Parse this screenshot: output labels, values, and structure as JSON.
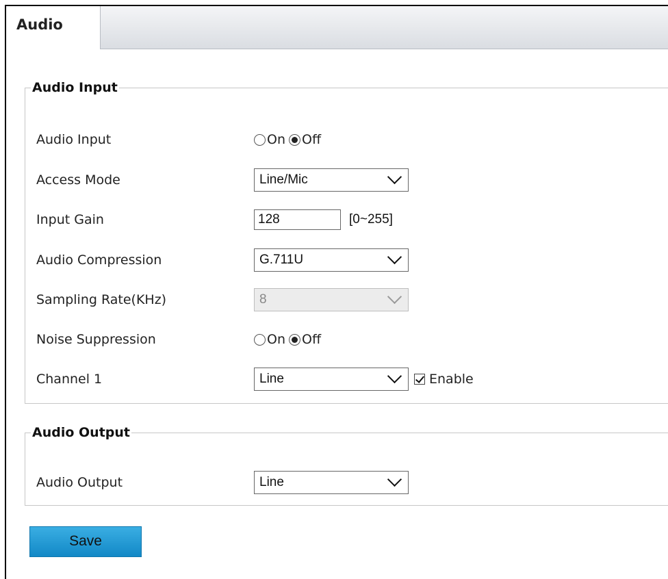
{
  "tabs": {
    "active_label": "Audio"
  },
  "audio_input": {
    "legend": "Audio Input",
    "audio_input": {
      "label": "Audio Input",
      "on_label": "On",
      "off_label": "Off",
      "selected": "Off"
    },
    "access_mode": {
      "label": "Access Mode",
      "value": "Line/Mic"
    },
    "input_gain": {
      "label": "Input Gain",
      "value": "128",
      "range": "[0~255]"
    },
    "audio_compression": {
      "label": "Audio Compression",
      "value": "G.711U"
    },
    "sampling_rate": {
      "label": "Sampling Rate(KHz)",
      "value": "8",
      "disabled": true
    },
    "noise_suppression": {
      "label": "Noise Suppression",
      "on_label": "On",
      "off_label": "Off",
      "selected": "Off"
    },
    "channel1": {
      "label": "Channel 1",
      "value": "Line",
      "enable_label": "Enable",
      "enabled": true
    }
  },
  "audio_output": {
    "legend": "Audio Output",
    "audio_output": {
      "label": "Audio Output",
      "value": "Line"
    }
  },
  "actions": {
    "save_label": "Save"
  },
  "colors": {
    "save_button": "#1a9ad6",
    "tabbar": "#dadde2",
    "border": "#c7c7c7"
  }
}
